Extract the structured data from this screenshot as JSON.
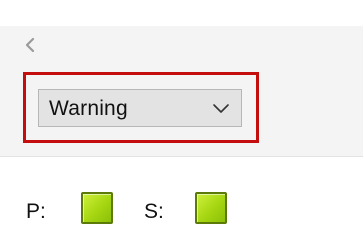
{
  "navigation": {
    "back_icon": "chevron-left-icon"
  },
  "severity_select": {
    "value": "Warning",
    "icon": "chevron-down-icon",
    "highlight_color": "#c40d0d"
  },
  "status": {
    "primary": {
      "label": "P:",
      "state_color": "#a6d611"
    },
    "secondary": {
      "label": "S:",
      "state_color": "#a6d611"
    }
  }
}
